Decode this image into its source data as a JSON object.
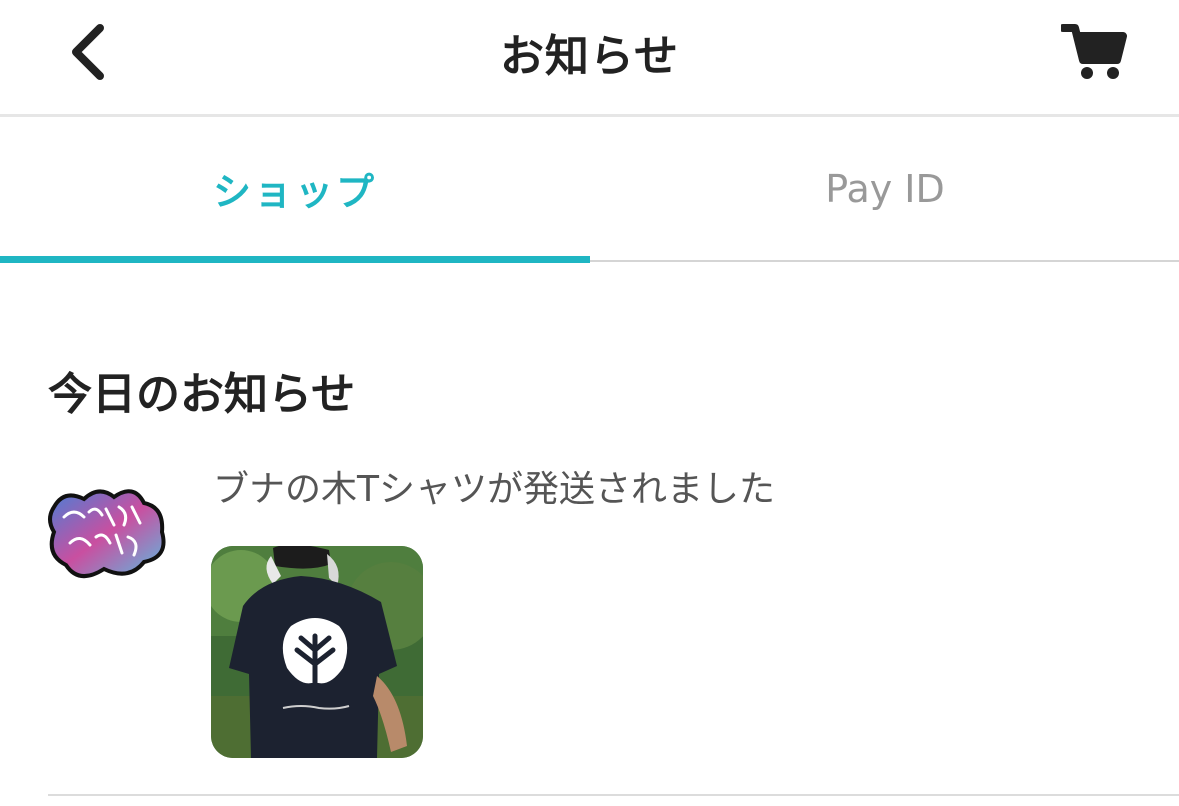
{
  "header": {
    "title": "お知らせ",
    "back_icon": "chevron-left-icon",
    "cart_icon": "cart-icon"
  },
  "tabs": [
    {
      "label": "ショップ",
      "active": true
    },
    {
      "label": "Pay ID",
      "active": false
    }
  ],
  "colors": {
    "accent": "#1fb6c3",
    "inactive_tab": "#999999",
    "text_primary": "#222222",
    "text_secondary": "#555555"
  },
  "section": {
    "title": "今日のお知らせ"
  },
  "notifications": [
    {
      "message": "ブナの木Tシャツが発送されました",
      "avatar_icon": "shop-logo-icon",
      "image": "tshirt-photo"
    }
  ]
}
